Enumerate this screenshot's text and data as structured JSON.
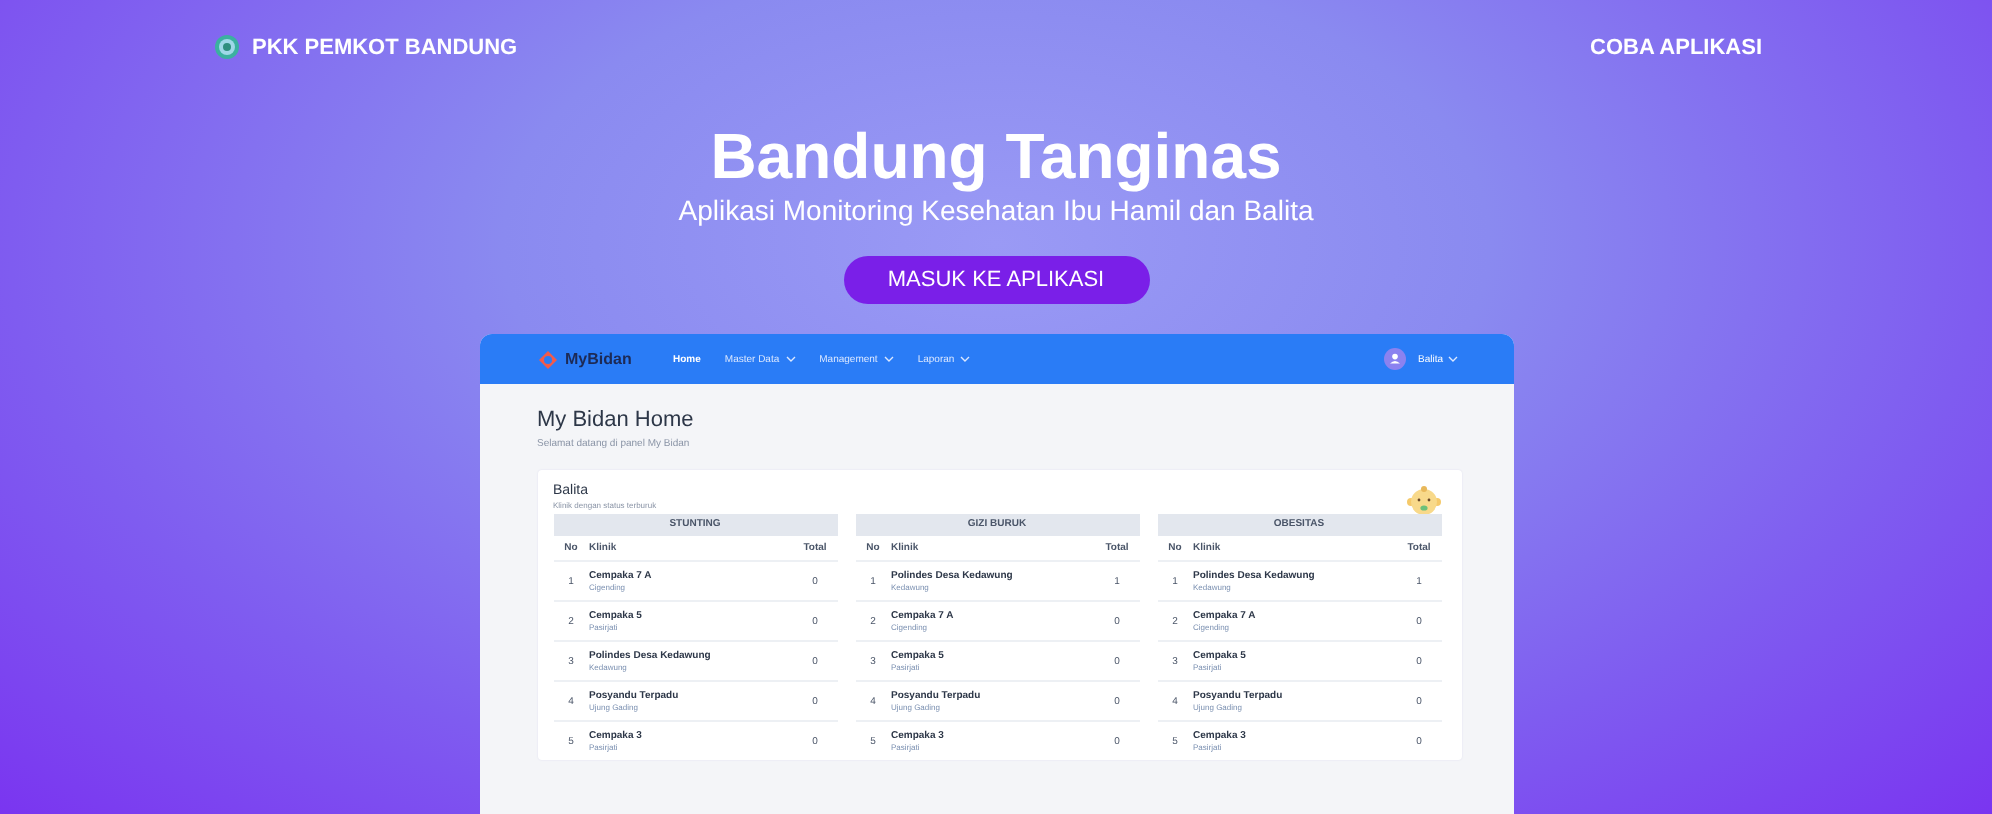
{
  "nav": {
    "brand": "PKK PEMKOT BANDUNG",
    "cta": "COBA APLIKASI"
  },
  "hero": {
    "title": "Bandung Tanginas",
    "subtitle": "Aplikasi Monitoring Kesehatan Ibu Hamil dan Balita",
    "button": "MASUK KE APLIKASI"
  },
  "preview": {
    "brand": "MyBidan",
    "menu": [
      {
        "label": "Home",
        "selected": true,
        "dropdown": false
      },
      {
        "label": "Master Data",
        "selected": false,
        "dropdown": true
      },
      {
        "label": "Management",
        "selected": false,
        "dropdown": true
      },
      {
        "label": "Laporan",
        "selected": false,
        "dropdown": true
      }
    ],
    "user": "Balita",
    "page_title": "My Bidan Home",
    "page_subtitle": "Selamat datang di panel My Bidan",
    "card": {
      "title": "Balita",
      "subtitle": "Klinik dengan status terburuk",
      "tables": [
        {
          "title": "STUNTING",
          "columns": [
            "No",
            "Klinik",
            "Total"
          ],
          "rows": [
            {
              "no": "1",
              "name": "Cempaka 7 A",
              "area": "Cigending",
              "total": "0"
            },
            {
              "no": "2",
              "name": "Cempaka 5",
              "area": "Pasirjati",
              "total": "0"
            },
            {
              "no": "3",
              "name": "Polindes Desa Kedawung",
              "area": "Kedawung",
              "total": "0"
            },
            {
              "no": "4",
              "name": "Posyandu Terpadu",
              "area": "Ujung Gading",
              "total": "0"
            },
            {
              "no": "5",
              "name": "Cempaka 3",
              "area": "Pasirjati",
              "total": "0"
            }
          ]
        },
        {
          "title": "GIZI BURUK",
          "columns": [
            "No",
            "Klinik",
            "Total"
          ],
          "rows": [
            {
              "no": "1",
              "name": "Polindes Desa Kedawung",
              "area": "Kedawung",
              "total": "1"
            },
            {
              "no": "2",
              "name": "Cempaka 7 A",
              "area": "Cigending",
              "total": "0"
            },
            {
              "no": "3",
              "name": "Cempaka 5",
              "area": "Pasirjati",
              "total": "0"
            },
            {
              "no": "4",
              "name": "Posyandu Terpadu",
              "area": "Ujung Gading",
              "total": "0"
            },
            {
              "no": "5",
              "name": "Cempaka 3",
              "area": "Pasirjati",
              "total": "0"
            }
          ]
        },
        {
          "title": "OBESITAS",
          "columns": [
            "No",
            "Klinik",
            "Total"
          ],
          "rows": [
            {
              "no": "1",
              "name": "Polindes Desa Kedawung",
              "area": "Kedawung",
              "total": "1"
            },
            {
              "no": "2",
              "name": "Cempaka 7 A",
              "area": "Cigending",
              "total": "0"
            },
            {
              "no": "3",
              "name": "Cempaka 5",
              "area": "Pasirjati",
              "total": "0"
            },
            {
              "no": "4",
              "name": "Posyandu Terpadu",
              "area": "Ujung Gading",
              "total": "0"
            },
            {
              "no": "5",
              "name": "Cempaka 3",
              "area": "Pasirjati",
              "total": "0"
            }
          ]
        }
      ]
    }
  }
}
